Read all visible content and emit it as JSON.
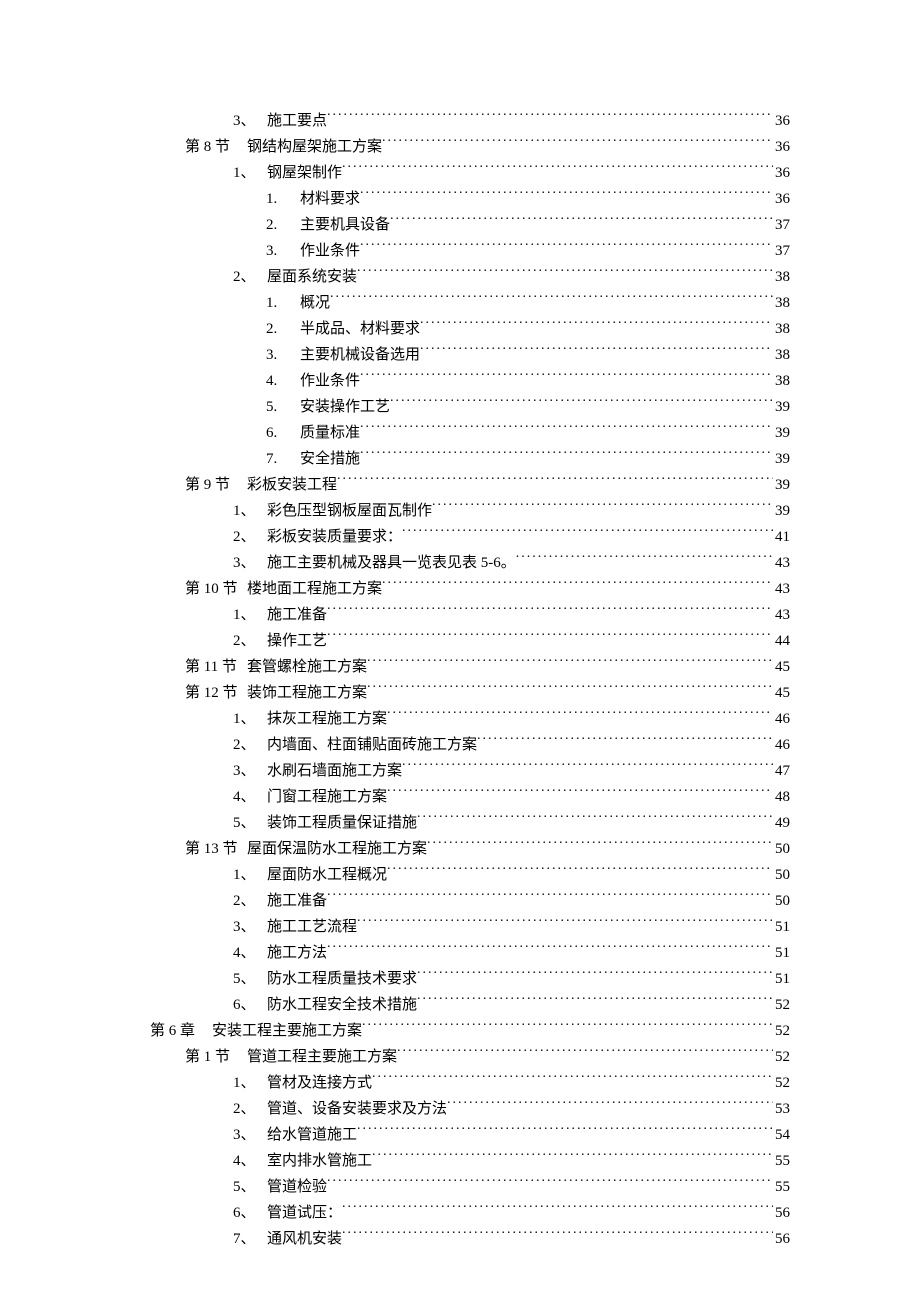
{
  "toc": [
    {
      "level": 3,
      "num": "3、",
      "label": "施工要点",
      "page": "36"
    },
    {
      "level": 2,
      "num": "第 8 节",
      "label": "钢结构屋架施工方案",
      "page": "36",
      "wide": true
    },
    {
      "level": 3,
      "num": "1、",
      "label": "钢屋架制作",
      "page": "36"
    },
    {
      "level": 4,
      "num": "1.",
      "label": "材料要求",
      "page": "36"
    },
    {
      "level": 4,
      "num": "2.",
      "label": "主要机具设备",
      "page": "37"
    },
    {
      "level": 4,
      "num": "3.",
      "label": "作业条件",
      "page": "37"
    },
    {
      "level": 3,
      "num": "2、",
      "label": "屋面系统安装",
      "page": "38"
    },
    {
      "level": 4,
      "num": "1.",
      "label": "概况",
      "page": "38"
    },
    {
      "level": 4,
      "num": "2.",
      "label": "半成品、材料要求",
      "page": "38"
    },
    {
      "level": 4,
      "num": "3.",
      "label": "主要机械设备选用",
      "page": "38"
    },
    {
      "level": 4,
      "num": "4.",
      "label": "作业条件",
      "page": "38"
    },
    {
      "level": 4,
      "num": "5.",
      "label": "安装操作工艺",
      "page": "39"
    },
    {
      "level": 4,
      "num": "6.",
      "label": "质量标准",
      "page": "39"
    },
    {
      "level": 4,
      "num": "7.",
      "label": "安全措施",
      "page": "39"
    },
    {
      "level": 2,
      "num": "第 9 节",
      "label": "彩板安装工程",
      "page": "39",
      "wide": true
    },
    {
      "level": 3,
      "num": "1、",
      "label": "彩色压型钢板屋面瓦制作",
      "page": "39"
    },
    {
      "level": 3,
      "num": "2、",
      "label": "彩板安装质量要求：",
      "page": "41"
    },
    {
      "level": 3,
      "num": "3、",
      "label": "施工主要机械及器具一览表见表 5-6。",
      "page": "43"
    },
    {
      "level": 2,
      "num": "第 10 节",
      "label": "楼地面工程施工方案",
      "page": "43",
      "wide": true
    },
    {
      "level": 3,
      "num": "1、",
      "label": "施工准备",
      "page": "43"
    },
    {
      "level": 3,
      "num": "2、",
      "label": "操作工艺",
      "page": "44"
    },
    {
      "level": 2,
      "num": "第 11 节",
      "label": "套管螺栓施工方案",
      "page": "45",
      "wide": true
    },
    {
      "level": 2,
      "num": "第 12 节",
      "label": "装饰工程施工方案",
      "page": "45",
      "wide": true
    },
    {
      "level": 3,
      "num": "1、",
      "label": "抹灰工程施工方案",
      "page": "46"
    },
    {
      "level": 3,
      "num": "2、",
      "label": "内墙面、柱面铺贴面砖施工方案",
      "page": "46"
    },
    {
      "level": 3,
      "num": "3、",
      "label": "水刷石墙面施工方案",
      "page": "47"
    },
    {
      "level": 3,
      "num": "4、",
      "label": "门窗工程施工方案",
      "page": "48"
    },
    {
      "level": 3,
      "num": "5、",
      "label": "装饰工程质量保证措施",
      "page": "49"
    },
    {
      "level": 2,
      "num": "第 13 节",
      "label": "屋面保温防水工程施工方案",
      "page": "50",
      "wide": true
    },
    {
      "level": 3,
      "num": "1、",
      "label": "屋面防水工程概况",
      "page": "50"
    },
    {
      "level": 3,
      "num": "2、",
      "label": "施工准备",
      "page": "50"
    },
    {
      "level": 3,
      "num": "3、",
      "label": "施工工艺流程",
      "page": "51"
    },
    {
      "level": 3,
      "num": "4、",
      "label": "施工方法",
      "page": "51"
    },
    {
      "level": 3,
      "num": "5、",
      "label": "防水工程质量技术要求",
      "page": "51"
    },
    {
      "level": 3,
      "num": "6、",
      "label": "防水工程安全技术措施",
      "page": "52"
    },
    {
      "level": 1,
      "num": "第 6 章",
      "label": "安装工程主要施工方案",
      "page": "52",
      "wide": true
    },
    {
      "level": 2,
      "num": "第 1 节",
      "label": "管道工程主要施工方案",
      "page": "52",
      "wide": true
    },
    {
      "level": 3,
      "num": "1、",
      "label": "管材及连接方式",
      "page": "52"
    },
    {
      "level": 3,
      "num": "2、",
      "label": "管道、设备安装要求及方法",
      "page": "53"
    },
    {
      "level": 3,
      "num": "3、",
      "label": "给水管道施工",
      "page": "54"
    },
    {
      "level": 3,
      "num": "4、",
      "label": "室内排水管施工",
      "page": "55"
    },
    {
      "level": 3,
      "num": "5、",
      "label": "管道检验",
      "page": "55"
    },
    {
      "level": 3,
      "num": "6、",
      "label": "管道试压：",
      "page": "56"
    },
    {
      "level": 3,
      "num": "7、",
      "label": "通风机安装",
      "page": "56"
    }
  ]
}
